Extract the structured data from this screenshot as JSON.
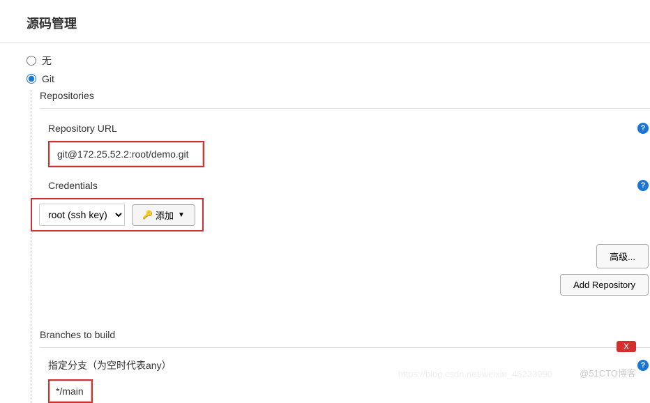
{
  "section": {
    "title": "源码管理"
  },
  "scm": {
    "none_label": "无",
    "git_label": "Git",
    "repositories_label": "Repositories",
    "repo_url_label": "Repository URL",
    "repo_url_value": "git@172.25.52.2:root/demo.git",
    "credentials_label": "Credentials",
    "credentials_selected": "root (ssh key)",
    "add_button_label": "添加",
    "advanced_button_label": "高级...",
    "add_repo_button_label": "Add Repository",
    "branches_label": "Branches to build",
    "branch_spec_label": "指定分支（为空时代表any）",
    "branch_value": "*/main",
    "delete_label": "X"
  },
  "watermark": {
    "text1": "https://blog.csdn.net/weixin_45233090",
    "text2": "@51CTO博客"
  }
}
